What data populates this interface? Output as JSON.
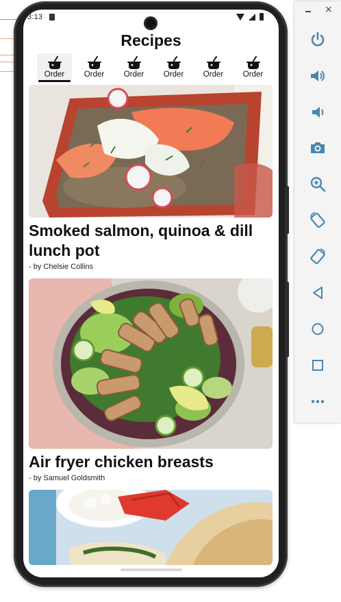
{
  "status_bar": {
    "time": "3:13"
  },
  "app": {
    "title": "Recipes"
  },
  "tabs": [
    {
      "label": "Order",
      "selected": true
    },
    {
      "label": "Order",
      "selected": false
    },
    {
      "label": "Order",
      "selected": false
    },
    {
      "label": "Order",
      "selected": false
    },
    {
      "label": "Order",
      "selected": false
    },
    {
      "label": "Order",
      "selected": false
    }
  ],
  "recipes": [
    {
      "title": "Smoked salmon, quinoa & dill lunch pot",
      "author": "- by Chelsie Collins"
    },
    {
      "title": "Air fryer chicken breasts",
      "author": "- by Samuel Goldsmith"
    }
  ],
  "emulator_toolbar": {
    "buttons": [
      "power-icon",
      "volume-up-icon",
      "volume-down-icon",
      "camera-icon",
      "zoom-icon",
      "rotate-left-icon",
      "rotate-right-icon",
      "back-icon",
      "home-icon",
      "overview-icon",
      "more-icon"
    ]
  },
  "colors": {
    "accent": "#3d7ea3",
    "salmon": "#f27b55",
    "avocado": "#7fb23b"
  }
}
